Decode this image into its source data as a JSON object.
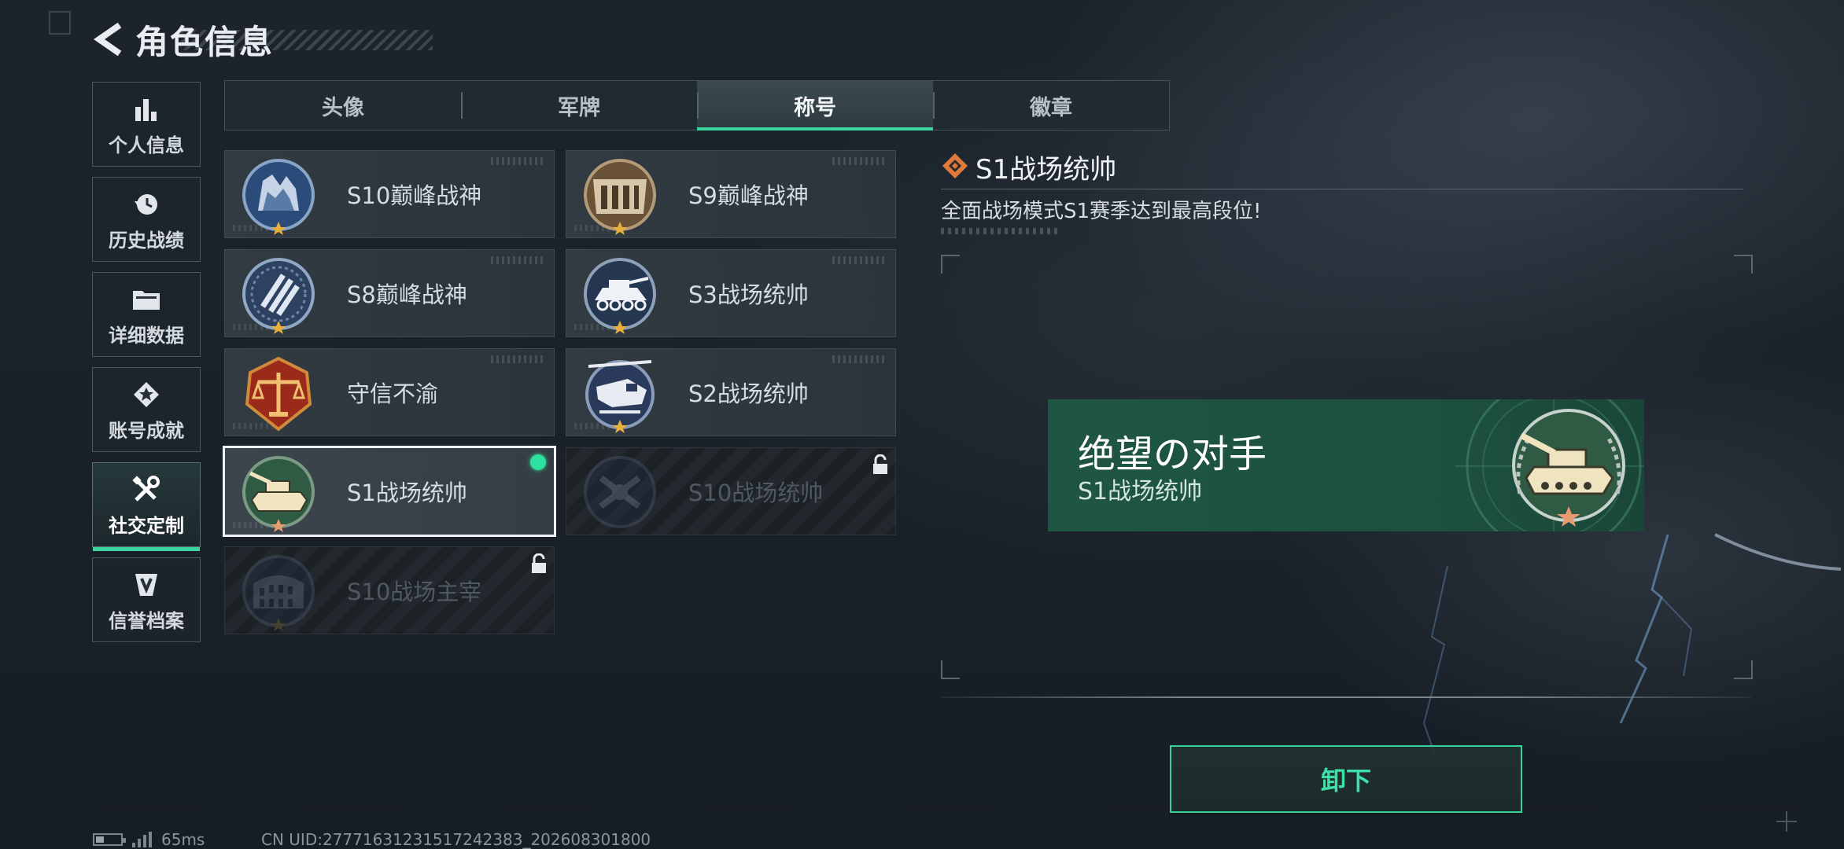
{
  "header": {
    "title": "角色信息"
  },
  "sidebar": {
    "items": [
      {
        "label": "个人信息",
        "icon": "bar-chart-icon",
        "active": false
      },
      {
        "label": "历史战绩",
        "icon": "history-clock-icon",
        "active": false
      },
      {
        "label": "详细数据",
        "icon": "folder-icon",
        "active": false
      },
      {
        "label": "账号成就",
        "icon": "achievement-icon",
        "active": false
      },
      {
        "label": "社交定制",
        "icon": "tools-icon",
        "active": true
      },
      {
        "label": "信誉档案",
        "icon": "credit-shield-icon",
        "active": false
      }
    ]
  },
  "tabs": [
    {
      "label": "头像",
      "active": false
    },
    {
      "label": "军牌",
      "active": false
    },
    {
      "label": "称号",
      "active": true
    },
    {
      "label": "徽章",
      "active": false
    }
  ],
  "titles": [
    {
      "label": "S10巅峰战神",
      "emblem": "fortress-emblem-icon",
      "state": "owned"
    },
    {
      "label": "S9巅峰战神",
      "emblem": "dam-emblem-icon",
      "state": "owned"
    },
    {
      "label": "S8巅峰战神",
      "emblem": "stripes-emblem-icon",
      "state": "owned"
    },
    {
      "label": "S3战场统帅",
      "emblem": "armored-vehicle-emblem-icon",
      "state": "owned"
    },
    {
      "label": "守信不渝",
      "emblem": "scales-emblem-icon",
      "state": "owned"
    },
    {
      "label": "S2战场统帅",
      "emblem": "helicopter-emblem-icon",
      "state": "owned"
    },
    {
      "label": "S1战场统帅",
      "emblem": "tank-emblem-icon",
      "state": "equipped"
    },
    {
      "label": "S10战场统帅",
      "emblem": "drone-emblem-icon",
      "state": "locked"
    },
    {
      "label": "S10战场主宰",
      "emblem": "colosseum-emblem-icon",
      "state": "locked"
    }
  ],
  "detail": {
    "title": "S1战场统帅",
    "description": "全面战场模式S1赛季达到最高段位!",
    "preview_name": "绝望の对手",
    "preview_subtitle": "S1战场统帅"
  },
  "actions": {
    "unequip_label": "卸下"
  },
  "status": {
    "ping": "65ms",
    "uid": "CN UID:27771631231517242383_202608301800"
  },
  "colors": {
    "accent": "#3bd6a0",
    "preview_bg": "#1f5643",
    "orange_diamond": "#e07a3a"
  }
}
